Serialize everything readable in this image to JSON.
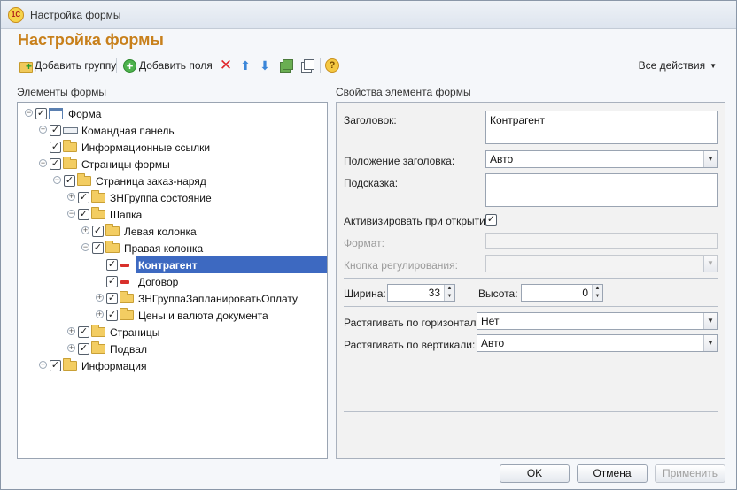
{
  "window": {
    "title": "Настройка формы",
    "logo_text": "1С"
  },
  "form_title": "Настройка формы",
  "toolbar": {
    "add_group": "Добавить группу",
    "add_fields": "Добавить поля",
    "all_actions": "Все действия",
    "dropdown_arrow": "▼"
  },
  "left_label": "Элементы формы",
  "right_label": "Свойства элемента формы",
  "tree": {
    "forma": "Форма",
    "command_panel": "Командная панель",
    "info_links": "Информационные ссылки",
    "form_pages": "Страницы формы",
    "page_order": "Страница заказ-наряд",
    "zn_group_state": "ЗНГруппа состояние",
    "header": "Шапка",
    "left_column": "Левая колонка",
    "right_column": "Правая колонка",
    "counterparty": "Контрагент",
    "contract": "Договор",
    "zn_group_plan_payment": "ЗНГруппаЗапланироватьОплату",
    "prices_currency": "Цены и валюта документа",
    "pages": "Страницы",
    "footer": "Подвал",
    "information": "Информация"
  },
  "props": {
    "title_label": "Заголовок:",
    "title_value": "Контрагент",
    "title_pos_label": "Положение заголовка:",
    "title_pos_value": "Авто",
    "hint_label": "Подсказка:",
    "hint_value": "",
    "activate_label": "Активизировать при открытии:",
    "activate_checked": true,
    "format_label": "Формат:",
    "format_value": "",
    "adjust_button_label": "Кнопка регулирования:",
    "adjust_button_value": "",
    "width_label": "Ширина:",
    "width_value": "33",
    "height_label": "Высота:",
    "height_value": "0",
    "stretch_h_label": "Растягивать по горизонтали:",
    "stretch_h_value": "Нет",
    "stretch_v_label": "Растягивать по вертикали:",
    "stretch_v_value": "Авто"
  },
  "footer": {
    "ok": "OK",
    "cancel": "Отмена",
    "apply": "Применить"
  },
  "colors": {
    "accent_title": "#c8801b",
    "selection": "#3d69c1"
  }
}
